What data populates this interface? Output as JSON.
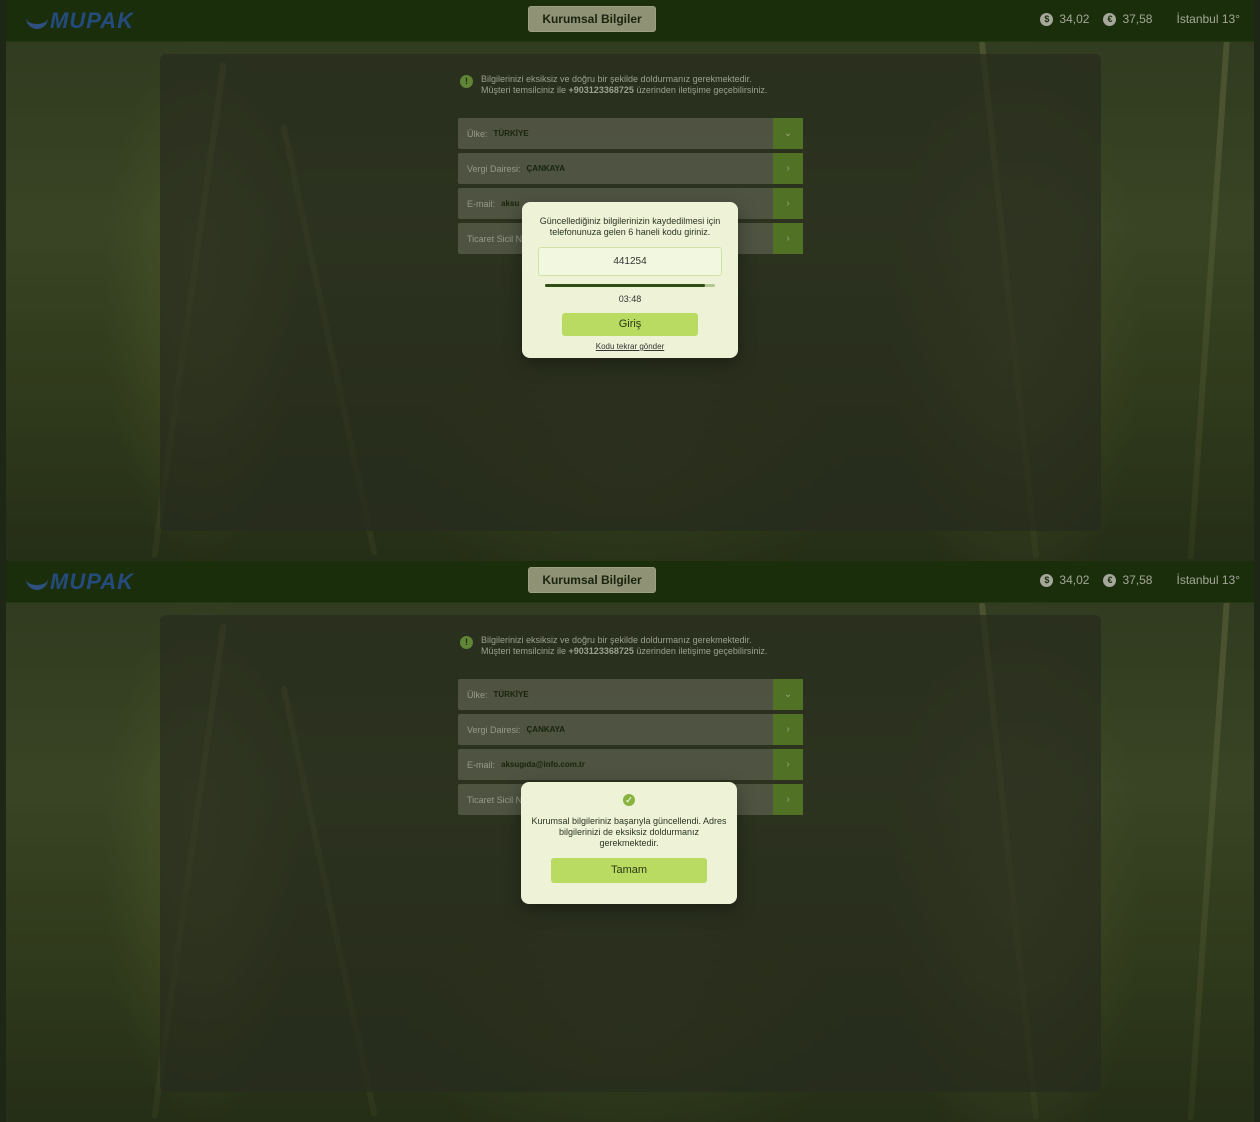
{
  "header": {
    "logo_text": "MUPAK",
    "title_button": "Kurumsal Bilgiler",
    "usd_icon": "dollar-icon",
    "usd_rate": "34,02",
    "eur_icon": "euro-icon",
    "eur_rate": "37,58",
    "weather": "İstanbul 13°"
  },
  "notice": {
    "icon": "info-icon",
    "line1": "Bilgilerinizi eksiksiz ve doğru bir şekilde doldurmanız gerekmektedir.",
    "line2_prefix": "Müşteri temsilciniz ile ",
    "phone": "+903123368725",
    "line2_suffix": " üzerinden iletişime geçebilirsiniz."
  },
  "fields": {
    "country_label": "Ülke:",
    "country_value": "TÜRKİYE",
    "tax_label": "Vergi Dairesi:",
    "tax_value": "ÇANKAYA",
    "email_label": "E-mail:",
    "email_value_frame1": "aksu",
    "email_value_frame2": "aksugıda@info.com.tr",
    "trade_label": "Ticaret Sicil N"
  },
  "otp_modal": {
    "message": "Güncellediğiniz bilgilerinizin kaydedilmesi için telefonunuza gelen 6 haneli kodu giriniz.",
    "code": "441254",
    "progress": 0.94,
    "timer": "03:48",
    "submit_label": "Giriş",
    "resend_label": "Kodu tekrar gönder"
  },
  "success_modal": {
    "icon": "check-circle-icon",
    "message": "Kurumsal bilgileriniz başarıyla güncellendi. Adres bilgilerinizi de eksiksiz doldurmanız gerekmektedir.",
    "ok_label": "Tamam"
  },
  "colors": {
    "topbar": "#1f3a0c",
    "accent": "#b9db62",
    "action_green": "#6e9a30",
    "modal_bg": "#eef3d8"
  }
}
